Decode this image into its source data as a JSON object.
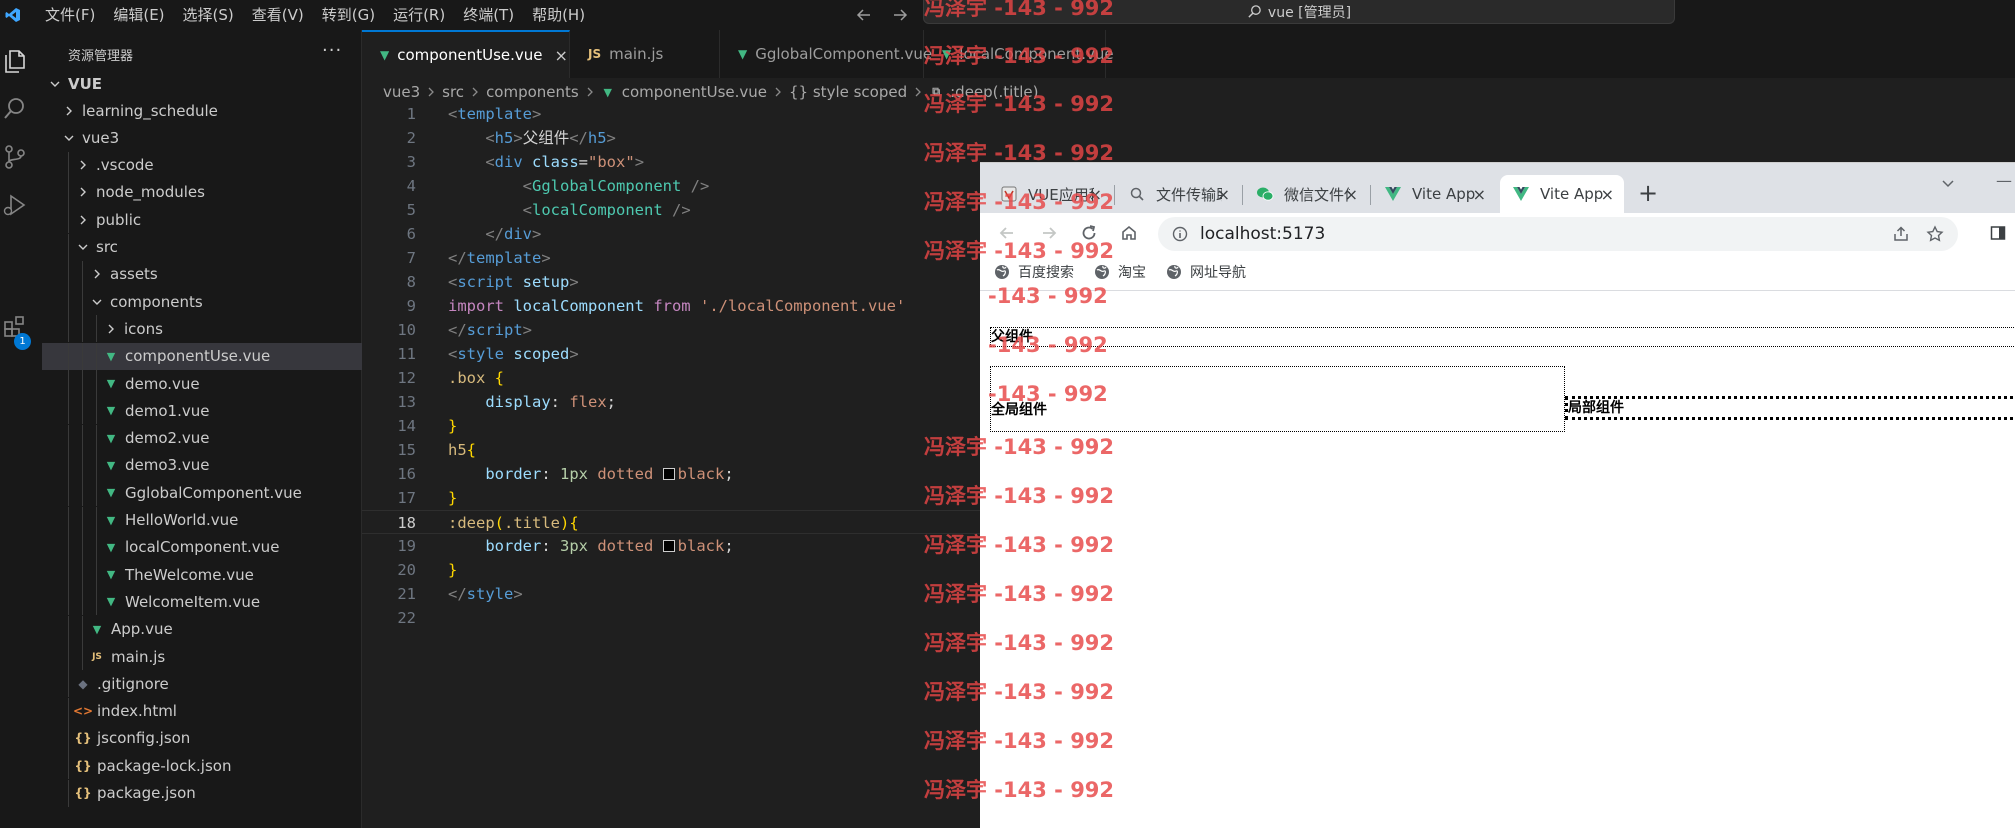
{
  "titlebar": {
    "menu": [
      "文件(F)",
      "编辑(E)",
      "选择(S)",
      "查看(V)",
      "转到(G)",
      "运行(R)",
      "终端(T)",
      "帮助(H)"
    ],
    "search_text": "vue [管理员]"
  },
  "activity": {
    "extensions_badge": "1"
  },
  "sidebar": {
    "title": "资源管理器",
    "more": "···",
    "root": "VUE",
    "items": [
      {
        "label": "learning_schedule",
        "kind": "folder",
        "open": false,
        "depth": 1
      },
      {
        "label": "vue3",
        "kind": "folder",
        "open": true,
        "depth": 1
      },
      {
        "label": ".vscode",
        "kind": "folder",
        "open": false,
        "depth": 2
      },
      {
        "label": "node_modules",
        "kind": "folder",
        "open": false,
        "depth": 2
      },
      {
        "label": "public",
        "kind": "folder",
        "open": false,
        "depth": 2
      },
      {
        "label": "src",
        "kind": "folder",
        "open": true,
        "depth": 2
      },
      {
        "label": "assets",
        "kind": "folder",
        "open": false,
        "depth": 3
      },
      {
        "label": "components",
        "kind": "folder",
        "open": true,
        "depth": 3
      },
      {
        "label": "icons",
        "kind": "folder",
        "open": false,
        "depth": 4
      },
      {
        "label": "componentUse.vue",
        "kind": "vue",
        "depth": 4,
        "selected": true
      },
      {
        "label": "demo.vue",
        "kind": "vue",
        "depth": 4
      },
      {
        "label": "demo1.vue",
        "kind": "vue",
        "depth": 4
      },
      {
        "label": "demo2.vue",
        "kind": "vue",
        "depth": 4
      },
      {
        "label": "demo3.vue",
        "kind": "vue",
        "depth": 4
      },
      {
        "label": "GglobalComponent.vue",
        "kind": "vue",
        "depth": 4
      },
      {
        "label": "HelloWorld.vue",
        "kind": "vue",
        "depth": 4
      },
      {
        "label": "localComponent.vue",
        "kind": "vue",
        "depth": 4
      },
      {
        "label": "TheWelcome.vue",
        "kind": "vue",
        "depth": 4
      },
      {
        "label": "WelcomeItem.vue",
        "kind": "vue",
        "depth": 4
      },
      {
        "label": "App.vue",
        "kind": "vue",
        "depth": 3
      },
      {
        "label": "main.js",
        "kind": "js",
        "depth": 3
      },
      {
        "label": ".gitignore",
        "kind": "git",
        "depth": 2
      },
      {
        "label": "index.html",
        "kind": "html",
        "depth": 2
      },
      {
        "label": "jsconfig.json",
        "kind": "json",
        "depth": 2
      },
      {
        "label": "package-lock.json",
        "kind": "json",
        "depth": 2
      },
      {
        "label": "package.json",
        "kind": "json",
        "depth": 2
      }
    ]
  },
  "editor": {
    "tabs": [
      {
        "label": "componentUse.vue",
        "kind": "vue",
        "active": true,
        "close": "×"
      },
      {
        "label": "main.js",
        "kind": "js",
        "active": false
      },
      {
        "label": "GglobalComponent.vue",
        "kind": "vue",
        "active": false
      },
      {
        "label": "localComponent.vue",
        "kind": "vue",
        "active": false
      }
    ],
    "breadcrumb": [
      "vue3",
      "src",
      "components",
      "componentUse.vue",
      "{} style scoped",
      ":deep(.title)"
    ],
    "current_line": 18,
    "lines": [
      [
        [
          "t-pun",
          "<"
        ],
        [
          "t-tag",
          "template"
        ],
        [
          "t-pun",
          ">"
        ]
      ],
      [
        [
          "t-plain",
          "    "
        ],
        [
          "t-pun",
          "<"
        ],
        [
          "t-tag",
          "h5"
        ],
        [
          "t-pun",
          ">"
        ],
        [
          "t-plain",
          "父组件"
        ],
        [
          "t-pun",
          "</"
        ],
        [
          "t-tag",
          "h5"
        ],
        [
          "t-pun",
          ">"
        ]
      ],
      [
        [
          "t-plain",
          "    "
        ],
        [
          "t-pun",
          "<"
        ],
        [
          "t-tag",
          "div "
        ],
        [
          "t-attr",
          "class"
        ],
        [
          "t-plain",
          "="
        ],
        [
          "t-str",
          "\"box\""
        ],
        [
          "t-pun",
          ">"
        ]
      ],
      [
        [
          "t-plain",
          "        "
        ],
        [
          "t-pun",
          "<"
        ],
        [
          "t-comp",
          "GglobalComponent"
        ],
        [
          "t-pun",
          " />"
        ]
      ],
      [
        [
          "t-plain",
          "        "
        ],
        [
          "t-pun",
          "<"
        ],
        [
          "t-comp",
          "localComponent"
        ],
        [
          "t-pun",
          " />"
        ]
      ],
      [
        [
          "t-plain",
          "    "
        ],
        [
          "t-pun",
          "</"
        ],
        [
          "t-tag",
          "div"
        ],
        [
          "t-pun",
          ">"
        ]
      ],
      [
        [
          "t-pun",
          "</"
        ],
        [
          "t-tag",
          "template"
        ],
        [
          "t-pun",
          ">"
        ]
      ],
      [
        [
          "t-pun",
          "<"
        ],
        [
          "t-tag",
          "script "
        ],
        [
          "t-attr",
          "setup"
        ],
        [
          "t-pun",
          ">"
        ]
      ],
      [
        [
          "t-kw",
          "import "
        ],
        [
          "t-id",
          "localComponent "
        ],
        [
          "t-kw",
          "from "
        ],
        [
          "t-str",
          "'./localComponent.vue'"
        ]
      ],
      [
        [
          "t-pun",
          "</"
        ],
        [
          "t-tag",
          "script"
        ],
        [
          "t-pun",
          ">"
        ]
      ],
      [
        [
          "t-pun",
          "<"
        ],
        [
          "t-tag",
          "style "
        ],
        [
          "t-attr",
          "scoped"
        ],
        [
          "t-pun",
          ">"
        ]
      ],
      [
        [
          "t-sel",
          ".box "
        ],
        [
          "t-brace",
          "{"
        ]
      ],
      [
        [
          "t-plain",
          "    "
        ],
        [
          "t-prop",
          "display"
        ],
        [
          "t-plain",
          ": "
        ],
        [
          "t-val",
          "flex"
        ],
        [
          "t-plain",
          ";"
        ]
      ],
      [
        [
          "t-brace",
          "}"
        ]
      ],
      [
        [
          "t-sel",
          "h5"
        ],
        [
          "t-brace",
          "{"
        ]
      ],
      [
        [
          "t-plain",
          "    "
        ],
        [
          "t-prop",
          "border"
        ],
        [
          "t-plain",
          ": "
        ],
        [
          "t-num",
          "1px "
        ],
        [
          "t-val",
          "dotted "
        ],
        [
          "swatch",
          ""
        ],
        [
          "t-val",
          "black"
        ],
        [
          "t-plain",
          ";"
        ]
      ],
      [
        [
          "t-brace",
          "}"
        ]
      ],
      [
        [
          "t-sel",
          ":deep"
        ],
        [
          "t-brace",
          "("
        ],
        [
          "t-sel",
          ".title"
        ],
        [
          "t-brace",
          ")"
        ],
        [
          "t-brace",
          "{"
        ]
      ],
      [
        [
          "t-plain",
          "    "
        ],
        [
          "t-prop",
          "border"
        ],
        [
          "t-plain",
          ": "
        ],
        [
          "t-num",
          "3px "
        ],
        [
          "t-val",
          "dotted "
        ],
        [
          "swatch",
          ""
        ],
        [
          "t-val",
          "black"
        ],
        [
          "t-plain",
          ";"
        ]
      ],
      [
        [
          "t-brace",
          "}"
        ]
      ],
      [
        [
          "t-pun",
          "</"
        ],
        [
          "t-tag",
          "style"
        ],
        [
          "t-pun",
          ">"
        ]
      ],
      [
        [
          "t-plain",
          ""
        ]
      ]
    ]
  },
  "watermark": {
    "text": "冯泽宇 -143 - 992",
    "partial_top": "冯泽宇 -143 - 992",
    "partial_left": "-143 - 992"
  },
  "browser": {
    "tabs": [
      {
        "label": "VUE应用程序",
        "icon": "vue-ish",
        "close": "×"
      },
      {
        "label": "文件传输助手",
        "icon": "search",
        "close": "×"
      },
      {
        "label": "微信文件传输",
        "icon": "wechat",
        "close": "×"
      },
      {
        "label": "Vite App",
        "icon": "vue",
        "close": "×"
      },
      {
        "label": "Vite App",
        "icon": "vue",
        "active": true,
        "close": "×"
      }
    ],
    "new_tab": "+",
    "url": "localhost:5173",
    "bookmarks": [
      "百度搜索",
      "淘宝",
      "网址导航"
    ],
    "page": {
      "h5": "父组件",
      "global": "全局组件",
      "local": "局部组件"
    }
  }
}
